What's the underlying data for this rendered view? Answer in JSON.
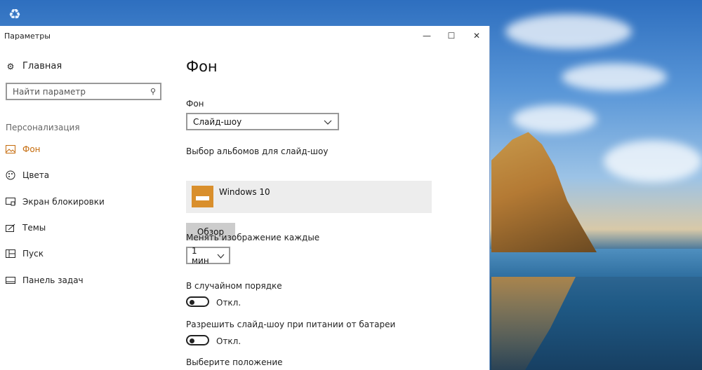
{
  "window": {
    "title": "Параметры"
  },
  "sidebar": {
    "home_label": "Главная",
    "search_placeholder": "Найти параметр",
    "section_label": "Персонализация",
    "items": [
      {
        "label": "Фон",
        "icon": "picture-icon",
        "active": true
      },
      {
        "label": "Цвета",
        "icon": "palette-icon",
        "active": false
      },
      {
        "label": "Экран блокировки",
        "icon": "lockscreen-icon",
        "active": false
      },
      {
        "label": "Темы",
        "icon": "themes-icon",
        "active": false
      },
      {
        "label": "Пуск",
        "icon": "start-icon",
        "active": false
      },
      {
        "label": "Панель задач",
        "icon": "taskbar-icon",
        "active": false
      }
    ]
  },
  "main": {
    "page_title": "Фон",
    "background_label": "Фон",
    "background_value": "Слайд-шоу",
    "albums_label": "Выбор альбомов для слайд-шоу",
    "album_name": "Windows 10",
    "browse_label": "Обзор",
    "interval_label": "Менять изображение каждые",
    "interval_value": "1 мин",
    "shuffle_label": "В случайном порядке",
    "shuffle_state": "Откл.",
    "battery_label": "Разрешить слайд-шоу при питании от батареи",
    "battery_state": "Откл.",
    "position_label": "Выберите положение"
  },
  "colors": {
    "accent": "#c56b0c",
    "album_thumb": "#d98f2c"
  }
}
